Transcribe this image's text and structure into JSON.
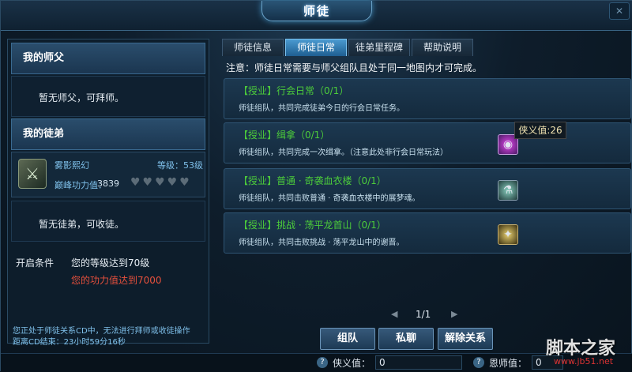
{
  "window": {
    "title": "师徒",
    "close_label": "✕"
  },
  "left": {
    "master_header": "我的师父",
    "master_empty": "暂无师父，可拜师。",
    "apprentice_header": "我的徒弟",
    "apprentice": {
      "name": "雾影熙幻",
      "level": "等级：53级",
      "power_label": "巅峰功力值：",
      "power_value": "3839",
      "hearts": "♥♥♥♥♥"
    },
    "apprentice_empty": "暂无徒弟，可收徒。",
    "condition_label": "开启条件",
    "condition_1": "您的等级达到70级",
    "condition_2": "您的功力值达到7000",
    "cd_note": "您正处于师徒关系CD中，无法进行拜师或收徒操作",
    "cd_time": "距离CD结束：23小时59分16秒"
  },
  "tabs": [
    {
      "label": "师徒信息",
      "active": false
    },
    {
      "label": "师徒日常",
      "active": true
    },
    {
      "label": "徒弟里程碑",
      "active": false
    },
    {
      "label": "帮助说明",
      "active": false
    }
  ],
  "notice": "注意：师徒日常需要与师父组队且处于同一地图内才可完成。",
  "tasks": [
    {
      "title": "【授业】行会日常（0/1）",
      "desc": "师徒组队，共同完成徒弟今日的行会日常任务。",
      "icon": ""
    },
    {
      "title": "【授业】缉拿（0/1）",
      "desc": "师徒组队，共同完成一次缉拿。（注意此处非行会日常玩法）",
      "icon": "orb-icon"
    },
    {
      "title": "【授业】普通 · 奇袭血衣楼（0/1）",
      "desc": "师徒组队，共同击败普通 · 奇袭血衣楼中的展梦魂。",
      "icon": "potion-icon"
    },
    {
      "title": "【授业】挑战 · 荡平龙首山（0/1）",
      "desc": "师徒组队，共同击败挑战 · 荡平龙山中的谢晋。",
      "icon": "relic-icon"
    }
  ],
  "tooltip": "侠义值:26",
  "pager": {
    "text": "1/1"
  },
  "buttons": {
    "team": "组队",
    "whisper": "私聊",
    "dissolve": "解除关系"
  },
  "bottom": {
    "chivalry_label": "侠义值：",
    "chivalry_value": "0",
    "mentor_label": "恩师值：",
    "mentor_value": "0"
  },
  "watermark": {
    "text": "脚本之家",
    "url": "www.jb51.net"
  },
  "colors": {
    "accent": "#4a9ad0",
    "task_title": "#4ccc3a",
    "warning": "#e8503c"
  }
}
